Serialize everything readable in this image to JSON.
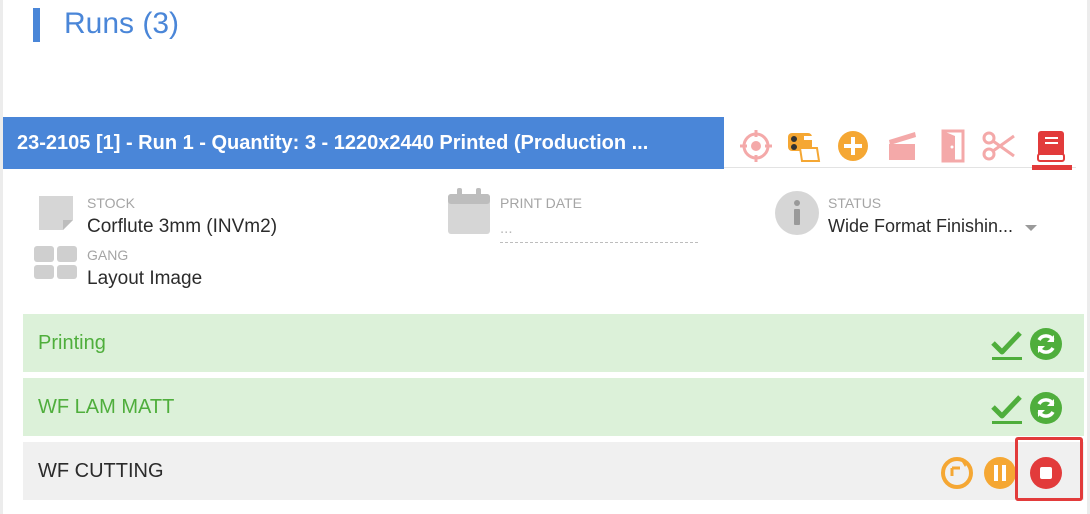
{
  "section": {
    "title": "Runs (3)"
  },
  "run": {
    "header": "23-2105 [1] - Run 1 - Quantity: 3 - 1220x2440 Printed (Production ...",
    "toolbar": [
      {
        "icon": "target-icon"
      },
      {
        "icon": "printer-stock-icon"
      },
      {
        "icon": "add-circle-icon"
      },
      {
        "icon": "clapper-icon"
      },
      {
        "icon": "door-icon"
      },
      {
        "icon": "scissors-icon"
      },
      {
        "icon": "book-icon",
        "active": true
      }
    ],
    "fields": {
      "stock": {
        "label": "STOCK",
        "value": "Corflute 3mm (INVm2)"
      },
      "gang": {
        "label": "GANG",
        "value": "Layout Image"
      },
      "print_date": {
        "label": "PRINT DATE",
        "value": "..."
      },
      "status": {
        "label": "STATUS",
        "value": "Wide Format Finishin..."
      }
    }
  },
  "stages": [
    {
      "name": "Printing",
      "state": "done"
    },
    {
      "name": "WF LAM MATT",
      "state": "done"
    },
    {
      "name": "WF CUTTING",
      "state": "active"
    }
  ],
  "colors": {
    "accent": "#4a86d8",
    "done_bg": "#dcf1d9",
    "done_text": "#4fae3c",
    "pending_orange": "#f5a733",
    "stop_red": "#e23b3b",
    "toolbar_faded": "#f4a9a9"
  }
}
